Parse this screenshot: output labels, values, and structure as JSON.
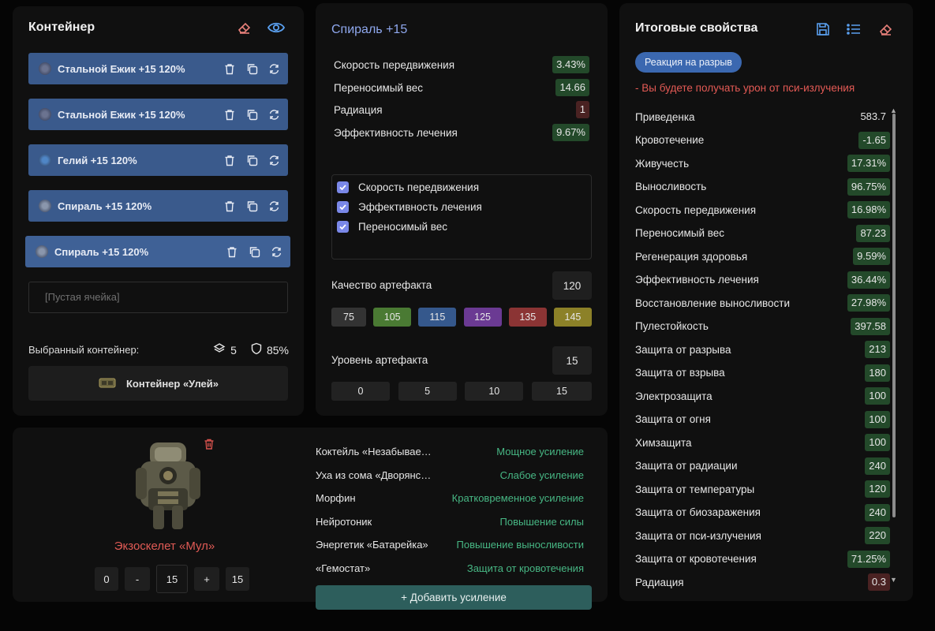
{
  "container": {
    "title": "Контейнер",
    "slots": [
      {
        "label": "Стальной Ежик +15 120%"
      },
      {
        "label": "Стальной Ежик +15 120%"
      },
      {
        "label": "Гелий +15 120%"
      },
      {
        "label": "Спираль +15 120%"
      },
      {
        "label": "Спираль +15 120%"
      }
    ],
    "empty_slot": "[Пустая ячейка]",
    "selected_label": "Выбранный контейнер:",
    "capacity": "5",
    "protection": "85%",
    "container_name": "Контейнер «Улей»"
  },
  "artifact": {
    "title": "Спираль +15",
    "props": [
      {
        "name": "Скорость передвижения",
        "value": "3.43%",
        "kind": "green"
      },
      {
        "name": "Переносимый вес",
        "value": "14.66",
        "kind": "green"
      },
      {
        "name": "Радиация",
        "value": "1",
        "kind": "red"
      },
      {
        "name": "Эффективность лечения",
        "value": "9.67%",
        "kind": "green"
      }
    ],
    "checks": [
      "Скорость передвижения",
      "Эффективность лечения",
      "Переносимый вес"
    ],
    "quality_label": "Качество артефакта",
    "quality_value": "120",
    "quality_presets": [
      {
        "label": "75",
        "color": "#333333"
      },
      {
        "label": "105",
        "color": "#4a7a33"
      },
      {
        "label": "115",
        "color": "#35588c"
      },
      {
        "label": "125",
        "color": "#6b3a93"
      },
      {
        "label": "135",
        "color": "#8b3434"
      },
      {
        "label": "145",
        "color": "#8c8128"
      }
    ],
    "level_label": "Уровень артефакта",
    "level_value": "15",
    "level_presets": [
      "0",
      "5",
      "10",
      "15"
    ]
  },
  "armor": {
    "name": "Экзоскелет «Мул»",
    "lvl_min": "0",
    "lvl_minus": "-",
    "lvl_value": "15",
    "lvl_plus": "+",
    "lvl_max": "15",
    "boosts": [
      {
        "name": "Коктейль «Незабываемый»",
        "effect": "Мощное усиление"
      },
      {
        "name": "Уха из сома «Дворянская»",
        "effect": "Слабое усиление"
      },
      {
        "name": "Морфин",
        "effect": "Кратковременное усиление"
      },
      {
        "name": "Нейротоник",
        "effect": "Повышение силы"
      },
      {
        "name": "Энергетик «Батарейка»",
        "effect": "Повышение выносливости"
      },
      {
        "name": "«Гемостат»",
        "effect": "Защита от кровотечения"
      }
    ],
    "add_boost": "+ Добавить усиление"
  },
  "summary": {
    "title": "Итоговые свойства",
    "reaction": "Реакция на разрыв",
    "warning": "- Вы будете получать урон от пси-излучения",
    "stats": [
      {
        "name": "Приведенка",
        "value": "583.7",
        "kind": "plain"
      },
      {
        "name": "Кровотечение",
        "value": "-1.65",
        "kind": "green"
      },
      {
        "name": "Живучесть",
        "value": "17.31%",
        "kind": "green"
      },
      {
        "name": "Выносливость",
        "value": "96.75%",
        "kind": "green"
      },
      {
        "name": "Скорость передвижения",
        "value": "16.98%",
        "kind": "green"
      },
      {
        "name": "Переносимый вес",
        "value": "87.23",
        "kind": "green"
      },
      {
        "name": "Регенерация здоровья",
        "value": "9.59%",
        "kind": "green"
      },
      {
        "name": "Эффективность лечения",
        "value": "36.44%",
        "kind": "green"
      },
      {
        "name": "Восстановление выносливости",
        "value": "27.98%",
        "kind": "green"
      },
      {
        "name": "Пулестойкость",
        "value": "397.58",
        "kind": "green"
      },
      {
        "name": "Защита от разрыва",
        "value": "213",
        "kind": "green"
      },
      {
        "name": "Защита от взрыва",
        "value": "180",
        "kind": "green"
      },
      {
        "name": "Электрозащита",
        "value": "100",
        "kind": "green"
      },
      {
        "name": "Защита от огня",
        "value": "100",
        "kind": "green"
      },
      {
        "name": "Химзащита",
        "value": "100",
        "kind": "green"
      },
      {
        "name": "Защита от радиации",
        "value": "240",
        "kind": "green"
      },
      {
        "name": "Защита от температуры",
        "value": "120",
        "kind": "green"
      },
      {
        "name": "Защита от биозаражения",
        "value": "240",
        "kind": "green"
      },
      {
        "name": "Защита от пси-излучения",
        "value": "220",
        "kind": "green"
      },
      {
        "name": "Защита от кровотечения",
        "value": "71.25%",
        "kind": "green"
      },
      {
        "name": "Радиация",
        "value": "0.3",
        "kind": "red"
      }
    ]
  }
}
